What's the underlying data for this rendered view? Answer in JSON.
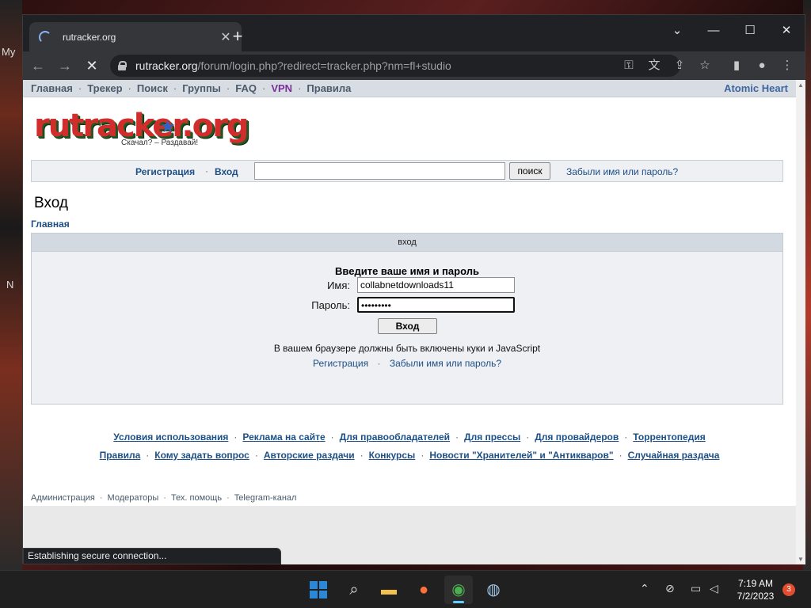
{
  "desktop": {
    "left_text": "My",
    "left_text2": "N"
  },
  "browser": {
    "tab_title": "rutracker.org",
    "tab_close": "✕",
    "new_tab": "+",
    "url_host": "rutracker.org",
    "url_path": "/forum/login.php?redirect=tracker.php?nm=fl+studio",
    "status_text": "Establishing secure connection..."
  },
  "site": {
    "nav": [
      "Главная",
      "Трекер",
      "Поиск",
      "Группы",
      "FAQ",
      "VPN",
      "Правила"
    ],
    "nav_sep": "·",
    "nav_right": "Atomic Heart",
    "logo_text": "rutracker.org",
    "logo_tagline": "Скачал? – Раздавай!",
    "loginbar": {
      "register": "Регистрация",
      "login": "Вход",
      "search_button": "поиск",
      "forgot": "Забыли имя или пароль?"
    },
    "page_title": "Вход",
    "breadcrumb": "Главная"
  },
  "login_panel": {
    "header": "вход",
    "subtitle": "Введите ваше имя и пароль",
    "username_label": "Имя:",
    "username_value": "collabnetdownloads11",
    "password_label": "Пароль:",
    "password_value": "•••••••••",
    "submit_label": "Вход",
    "notice": "В вашем браузере должны быть включены куки и JavaScript",
    "register_link": "Регистрация",
    "forgot_link": "Забыли имя или пароль?",
    "sep": "·"
  },
  "footer": {
    "row1": [
      "Условия использования",
      "Реклама на сайте",
      "Для правообладателей",
      "Для прессы",
      "Для провайдеров",
      "Торрентопедия"
    ],
    "row2": [
      "Правила",
      "Кому задать вопрос",
      "Авторские раздачи",
      "Конкурсы",
      "Новости \"Хранителей\" и \"Антикваров\"",
      "Случайная раздача"
    ],
    "bottom": [
      "Администрация",
      "Модераторы",
      "Тех. помощь",
      "Telegram-канал"
    ],
    "sep": "·"
  },
  "taskbar": {
    "time": "7:19 AM",
    "date": "7/2/2023",
    "notifications": "3"
  },
  "colors": {
    "link": "#1c4f86",
    "nav_bg": "#d8dde4",
    "panel_bg": "#eef0f3",
    "vpn": "#7b2f9a",
    "chrome_dark": "#202124"
  }
}
